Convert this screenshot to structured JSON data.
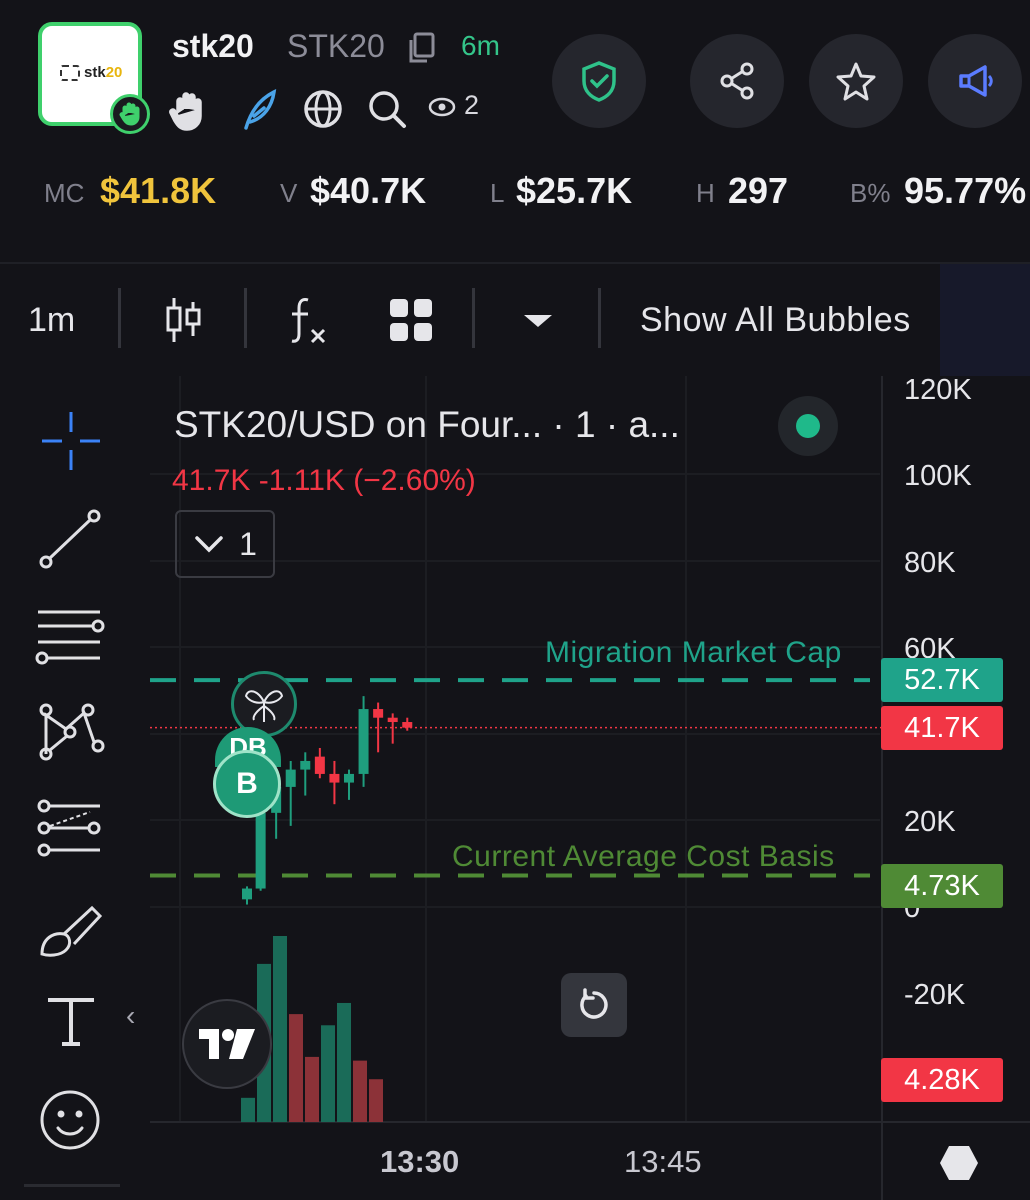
{
  "token": {
    "logo_text_a": "stk",
    "logo_text_b": "20",
    "name": "stk20",
    "ticker": "STK20",
    "age": "6m",
    "watchers": "2"
  },
  "stats": {
    "mc_label": "MC",
    "mc_value": "$41.8K",
    "v_label": "V",
    "v_value": "$40.7K",
    "l_label": "L",
    "l_value": "$25.7K",
    "h_label": "H",
    "h_value": "297",
    "b_label": "B%",
    "b_value": "95.77%"
  },
  "toolbar": {
    "interval": "1m",
    "bubbles_label": "Show All Bubbles"
  },
  "chart": {
    "title": "STK20/USD on Four... · 1 · a...",
    "quote": "41.7K  -1.11K (−2.60%)",
    "legend_count": "1",
    "migration_label": "Migration Market Cap",
    "cost_basis_label": "Current Average Cost Basis",
    "bubble_b_label": "B",
    "bubble_db_label": "DB",
    "tv_logo_text": "TV",
    "colors": {
      "up": "#1f9e7e",
      "down": "#f23645",
      "migration": "#1fa38a",
      "cost_basis": "#4f8a35",
      "tag_green": "#1fa38a",
      "tag_red": "#f23645",
      "tag_olive": "#4f8a35"
    }
  },
  "chart_data": {
    "type": "candlestick",
    "yaxis": {
      "labels": [
        "120K",
        "100K",
        "80K",
        "60K",
        "20K",
        "0",
        "-20K"
      ],
      "ylim": [
        -20000,
        120000
      ]
    },
    "price_tags": {
      "migration": "52.7K",
      "current": "41.7K",
      "cost_basis": "4.73K",
      "volume": "4.28K"
    },
    "xaxis": {
      "labels": [
        "13:30",
        "13:45"
      ]
    },
    "candles": [
      {
        "o": 2000,
        "h": 5000,
        "l": 800,
        "c": 4500
      },
      {
        "o": 4500,
        "h": 25000,
        "l": 4000,
        "c": 22000
      },
      {
        "o": 22000,
        "h": 30000,
        "l": 16000,
        "c": 28000
      },
      {
        "o": 28000,
        "h": 34000,
        "l": 19000,
        "c": 32000
      },
      {
        "o": 32000,
        "h": 36000,
        "l": 26000,
        "c": 34000
      },
      {
        "o": 35000,
        "h": 37000,
        "l": 30000,
        "c": 31000
      },
      {
        "o": 31000,
        "h": 34000,
        "l": 24000,
        "c": 29000
      },
      {
        "o": 29000,
        "h": 32000,
        "l": 25000,
        "c": 31000
      },
      {
        "o": 31000,
        "h": 49000,
        "l": 28000,
        "c": 46000
      },
      {
        "o": 46000,
        "h": 47500,
        "l": 36000,
        "c": 44000
      },
      {
        "o": 44000,
        "h": 45000,
        "l": 38000,
        "c": 43000
      },
      {
        "o": 43000,
        "h": 44000,
        "l": 41000,
        "c": 41700
      }
    ],
    "volumes": [
      {
        "v": 0.13,
        "dir": "up"
      },
      {
        "v": 0.85,
        "dir": "up"
      },
      {
        "v": 1.0,
        "dir": "up"
      },
      {
        "v": 0.58,
        "dir": "down"
      },
      {
        "v": 0.35,
        "dir": "down"
      },
      {
        "v": 0.52,
        "dir": "up"
      },
      {
        "v": 0.64,
        "dir": "up"
      },
      {
        "v": 0.33,
        "dir": "down"
      },
      {
        "v": 0.23,
        "dir": "down"
      }
    ],
    "migration_level": 52700,
    "cost_basis_level": 4730,
    "current_price": 41700
  }
}
